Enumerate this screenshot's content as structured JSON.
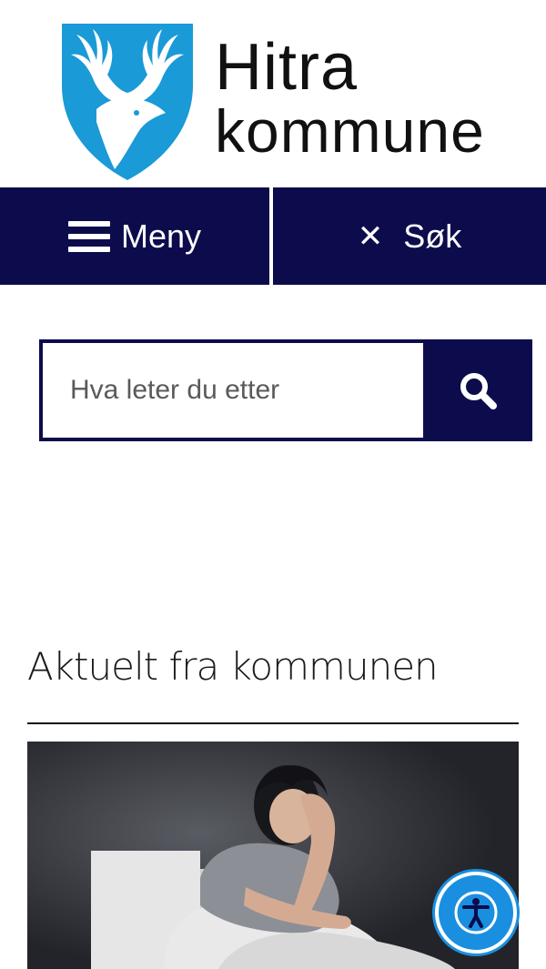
{
  "logo": {
    "line1": "Hitra",
    "line2": "kommune"
  },
  "nav": {
    "menu_label": "Meny",
    "search_label": "Søk"
  },
  "search": {
    "placeholder": "Hva leter du etter"
  },
  "section": {
    "title": "Aktuelt fra kommunen"
  },
  "colors": {
    "navy": "#0c0c4d",
    "logo_blue": "#1a9ad6",
    "a11y_blue": "#1a8fe0"
  },
  "icons": [
    "hamburger-icon",
    "close-icon",
    "search-icon",
    "accessibility-icon"
  ]
}
